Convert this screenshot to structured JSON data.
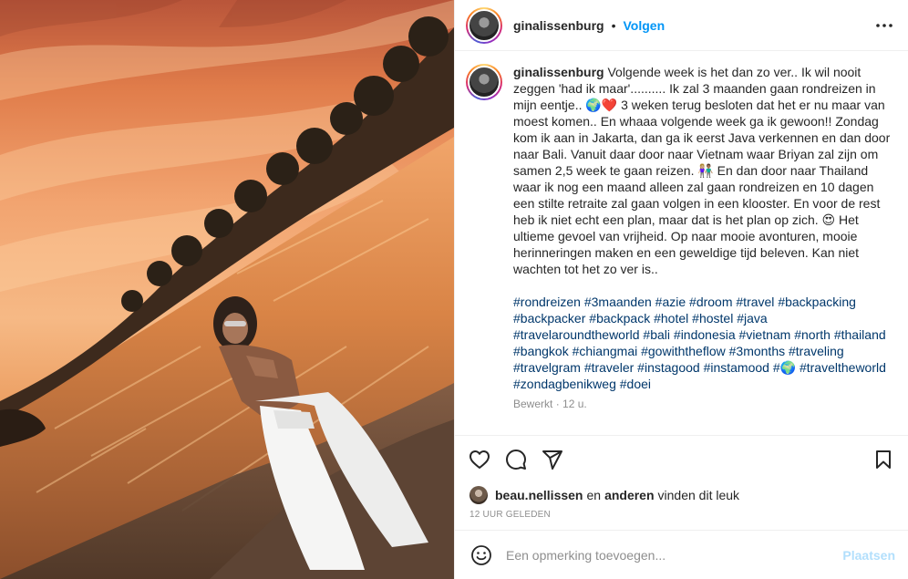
{
  "header": {
    "username": "ginalissenburg",
    "separator": "•",
    "follow_label": "Volgen",
    "more_icon": "more-horizontal-icon"
  },
  "caption": {
    "username": "ginalissenburg",
    "text": "Volgende week is het dan zo ver.. Ik wil nooit zeggen 'had ik maar'.......... Ik zal 3 maanden gaan rondreizen in mijn eentje.. 🌍❤️ 3 weken terug besloten dat het er nu maar van moest komen.. En whaaa volgende week ga ik gewoon!! Zondag kom ik aan in Jakarta, dan ga ik eerst Java verkennen en dan door naar Bali. Vanuit daar door naar Vietnam waar Briyan zal zijn om samen 2,5 week te gaan reizen. 👩🏼‍🤝‍👨🏽 En dan door naar Thailand waar ik nog een maand alleen zal gaan rondreizen en 10 dagen een stilte retraite zal gaan volgen in een klooster. En voor de rest heb ik niet echt een plan, maar dat is het plan op zich. 😍 Het ultieme gevoel van vrijheid. Op naar mooie avonturen, mooie herinneringen maken en een geweldige tijd beleven. Kan niet wachten tot het zo ver is..",
    "hashtags": [
      "#rondreizen",
      "#3maanden",
      "#azie",
      "#droom",
      "#travel",
      "#backpacking",
      "#backpacker",
      "#backpack",
      "#hotel",
      "#hostel",
      "#java",
      "#travelaroundtheworld",
      "#bali",
      "#indonesia",
      "#vietnam",
      "#north",
      "#thailand",
      "#bangkok",
      "#chiangmai",
      "#gowiththeflow",
      "#3months",
      "#traveling",
      "#travelgram",
      "#traveler",
      "#instagood",
      "#instamood",
      "#🌍",
      "#traveltheworld",
      "#zondagbenikweg",
      "#doei"
    ],
    "edited": "Bewerkt",
    "meta_separator": "·",
    "time": "12 u."
  },
  "actions": {
    "like_icon": "heart-icon",
    "comment_icon": "comment-icon",
    "share_icon": "share-icon",
    "save_icon": "bookmark-icon"
  },
  "likes": {
    "first_user": "beau.nellissen",
    "connector": "en",
    "others": "anderen",
    "suffix": "vinden dit leuk"
  },
  "timestamp": "12 UUR GELEDEN",
  "add_comment": {
    "emoji_icon": "emoji-icon",
    "placeholder": "Een opmerking toevoegen...",
    "post_label": "Plaatsen"
  },
  "colors": {
    "link_blue": "#0095f6",
    "hashtag_blue": "#00376b",
    "post_disabled": "#b2dffc",
    "muted": "#8e8e8e"
  }
}
